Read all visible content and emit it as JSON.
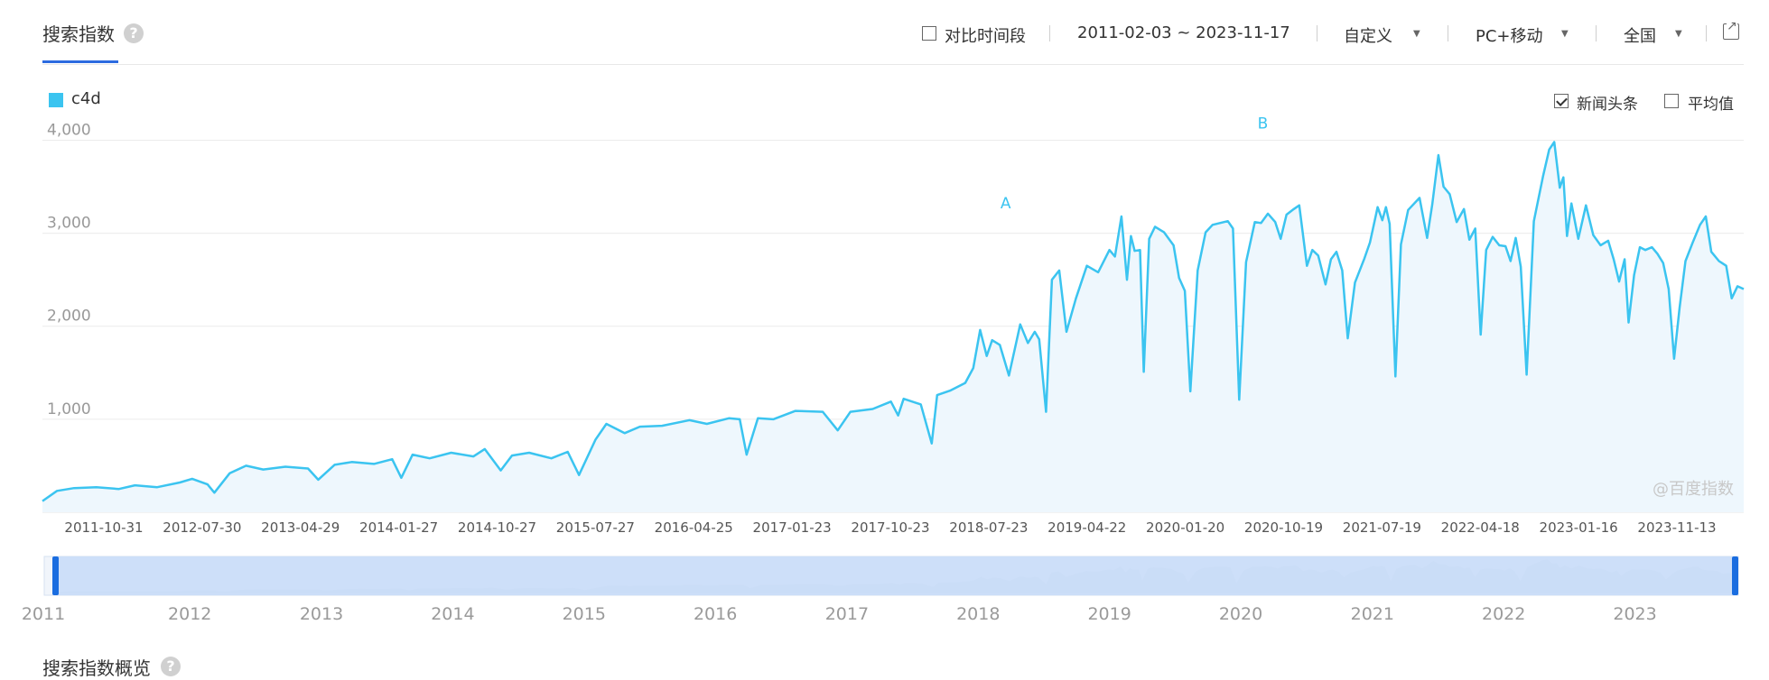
{
  "header": {
    "title": "搜索指数",
    "help_glyph": "?",
    "compare_label": "对比时间段",
    "date_range": "2011-02-03 ~ 2023-11-17",
    "mode_label": "自定义",
    "device_label": "PC+移动",
    "region_label": "全国"
  },
  "options": {
    "news_label": "新闻头条",
    "news_checked": true,
    "avg_label": "平均值",
    "avg_checked": false
  },
  "watermark": "@百度指数",
  "overview_title": "搜索指数概览",
  "colors": {
    "line": "#3bc4f0",
    "fill": "#eef7fd",
    "slider_fill": "#c7daf8",
    "slider_handle": "#1a6de0"
  },
  "chart_data": {
    "type": "area",
    "series": [
      {
        "name": "c4d"
      }
    ],
    "x_tick_labels": [
      "2011-10-31",
      "2012-07-30",
      "2013-04-29",
      "2014-01-27",
      "2014-10-27",
      "2015-07-27",
      "2016-04-25",
      "2017-01-23",
      "2017-10-23",
      "2018-07-23",
      "2019-04-22",
      "2020-01-20",
      "2020-10-19",
      "2021-07-19",
      "2022-04-18",
      "2023-01-16",
      "2023-11-13"
    ],
    "y_tick_labels": [
      "1,000",
      "2,000",
      "3,000",
      "4,000"
    ],
    "y_ticks": [
      1000,
      2000,
      3000,
      4000
    ],
    "ylim": [
      0,
      4150
    ],
    "xlim": [
      "2011-02-03",
      "2023-11-17"
    ],
    "annotations": [
      {
        "label": "A",
        "date": "2018-05-01",
        "value": 3130
      },
      {
        "label": "B",
        "date": "2020-04-06",
        "value": 3990
      }
    ],
    "points": [
      [
        "2011-02-03",
        120
      ],
      [
        "2011-03-15",
        230
      ],
      [
        "2011-05-01",
        260
      ],
      [
        "2011-07-01",
        270
      ],
      [
        "2011-09-01",
        250
      ],
      [
        "2011-10-15",
        290
      ],
      [
        "2011-12-15",
        270
      ],
      [
        "2012-02-15",
        320
      ],
      [
        "2012-03-20",
        360
      ],
      [
        "2012-05-01",
        300
      ],
      [
        "2012-05-20",
        210
      ],
      [
        "2012-07-01",
        420
      ],
      [
        "2012-08-15",
        500
      ],
      [
        "2012-10-01",
        460
      ],
      [
        "2012-12-01",
        490
      ],
      [
        "2013-02-01",
        470
      ],
      [
        "2013-03-01",
        350
      ],
      [
        "2013-04-15",
        510
      ],
      [
        "2013-06-01",
        540
      ],
      [
        "2013-08-01",
        520
      ],
      [
        "2013-09-20",
        570
      ],
      [
        "2013-10-15",
        370
      ],
      [
        "2013-11-15",
        620
      ],
      [
        "2014-01-01",
        580
      ],
      [
        "2014-03-01",
        640
      ],
      [
        "2014-05-01",
        600
      ],
      [
        "2014-06-01",
        680
      ],
      [
        "2014-07-15",
        450
      ],
      [
        "2014-08-15",
        610
      ],
      [
        "2014-10-01",
        640
      ],
      [
        "2014-12-01",
        580
      ],
      [
        "2015-01-15",
        650
      ],
      [
        "2015-02-15",
        400
      ],
      [
        "2015-04-01",
        780
      ],
      [
        "2015-05-01",
        950
      ],
      [
        "2015-06-20",
        850
      ],
      [
        "2015-08-01",
        920
      ],
      [
        "2015-10-01",
        930
      ],
      [
        "2015-12-15",
        990
      ],
      [
        "2016-02-01",
        950
      ],
      [
        "2016-04-01",
        1010
      ],
      [
        "2016-05-01",
        1000
      ],
      [
        "2016-05-20",
        620
      ],
      [
        "2016-06-20",
        1010
      ],
      [
        "2016-08-01",
        1000
      ],
      [
        "2016-10-01",
        1090
      ],
      [
        "2016-12-15",
        1080
      ],
      [
        "2017-01-25",
        880
      ],
      [
        "2017-03-01",
        1080
      ],
      [
        "2017-05-01",
        1110
      ],
      [
        "2017-06-20",
        1190
      ],
      [
        "2017-07-10",
        1040
      ],
      [
        "2017-07-25",
        1220
      ],
      [
        "2017-09-10",
        1160
      ],
      [
        "2017-10-10",
        740
      ],
      [
        "2017-10-25",
        1260
      ],
      [
        "2017-12-01",
        1310
      ],
      [
        "2018-01-10",
        1390
      ],
      [
        "2018-02-01",
        1550
      ],
      [
        "2018-02-20",
        1960
      ],
      [
        "2018-03-10",
        1680
      ],
      [
        "2018-03-25",
        1850
      ],
      [
        "2018-04-15",
        1800
      ],
      [
        "2018-05-10",
        1470
      ],
      [
        "2018-06-10",
        2020
      ],
      [
        "2018-07-01",
        1820
      ],
      [
        "2018-07-20",
        1940
      ],
      [
        "2018-08-01",
        1860
      ],
      [
        "2018-08-20",
        1080
      ],
      [
        "2018-09-05",
        2500
      ],
      [
        "2018-09-25",
        2600
      ],
      [
        "2018-10-15",
        1940
      ],
      [
        "2018-11-10",
        2300
      ],
      [
        "2018-12-10",
        2650
      ],
      [
        "2019-01-10",
        2580
      ],
      [
        "2019-02-10",
        2820
      ],
      [
        "2019-02-25",
        2750
      ],
      [
        "2019-03-15",
        3180
      ],
      [
        "2019-03-30",
        2500
      ],
      [
        "2019-04-10",
        2970
      ],
      [
        "2019-04-20",
        2810
      ],
      [
        "2019-05-05",
        2820
      ],
      [
        "2019-05-15",
        1510
      ],
      [
        "2019-05-30",
        2940
      ],
      [
        "2019-06-15",
        3070
      ],
      [
        "2019-07-10",
        3010
      ],
      [
        "2019-08-05",
        2870
      ],
      [
        "2019-08-20",
        2520
      ],
      [
        "2019-09-05",
        2380
      ],
      [
        "2019-09-20",
        1300
      ],
      [
        "2019-10-10",
        2600
      ],
      [
        "2019-11-01",
        3010
      ],
      [
        "2019-11-20",
        3090
      ],
      [
        "2019-12-10",
        3110
      ],
      [
        "2020-01-01",
        3130
      ],
      [
        "2020-01-15",
        3050
      ],
      [
        "2020-02-01",
        1210
      ],
      [
        "2020-02-20",
        2690
      ],
      [
        "2020-03-15",
        3120
      ],
      [
        "2020-04-01",
        3110
      ],
      [
        "2020-04-20",
        3210
      ],
      [
        "2020-05-10",
        3120
      ],
      [
        "2020-05-25",
        2940
      ],
      [
        "2020-06-10",
        3200
      ],
      [
        "2020-06-30",
        3260
      ],
      [
        "2020-07-15",
        3300
      ],
      [
        "2020-08-05",
        2650
      ],
      [
        "2020-08-20",
        2820
      ],
      [
        "2020-09-05",
        2760
      ],
      [
        "2020-09-25",
        2450
      ],
      [
        "2020-10-10",
        2720
      ],
      [
        "2020-10-25",
        2800
      ],
      [
        "2020-11-10",
        2600
      ],
      [
        "2020-11-25",
        1870
      ],
      [
        "2020-12-15",
        2470
      ],
      [
        "2021-01-10",
        2730
      ],
      [
        "2021-01-25",
        2900
      ],
      [
        "2021-02-15",
        3280
      ],
      [
        "2021-02-28",
        3140
      ],
      [
        "2021-03-10",
        3280
      ],
      [
        "2021-03-20",
        3100
      ],
      [
        "2021-04-05",
        1460
      ],
      [
        "2021-04-20",
        2880
      ],
      [
        "2021-05-10",
        3250
      ],
      [
        "2021-06-10",
        3380
      ],
      [
        "2021-07-01",
        2950
      ],
      [
        "2021-07-15",
        3310
      ],
      [
        "2021-08-01",
        3840
      ],
      [
        "2021-08-15",
        3500
      ],
      [
        "2021-09-01",
        3420
      ],
      [
        "2021-09-20",
        3120
      ],
      [
        "2021-10-10",
        3260
      ],
      [
        "2021-10-25",
        2930
      ],
      [
        "2021-11-10",
        3050
      ],
      [
        "2021-11-25",
        1910
      ],
      [
        "2021-12-10",
        2820
      ],
      [
        "2021-12-28",
        2960
      ],
      [
        "2022-01-15",
        2870
      ],
      [
        "2022-02-01",
        2860
      ],
      [
        "2022-02-15",
        2700
      ],
      [
        "2022-03-01",
        2950
      ],
      [
        "2022-03-15",
        2640
      ],
      [
        "2022-03-31",
        1480
      ],
      [
        "2022-04-20",
        3130
      ],
      [
        "2022-05-15",
        3610
      ],
      [
        "2022-06-01",
        3900
      ],
      [
        "2022-06-15",
        3980
      ],
      [
        "2022-06-30",
        3490
      ],
      [
        "2022-07-10",
        3600
      ],
      [
        "2022-07-20",
        2970
      ],
      [
        "2022-08-01",
        3320
      ],
      [
        "2022-08-20",
        2940
      ],
      [
        "2022-09-10",
        3300
      ],
      [
        "2022-09-30",
        2980
      ],
      [
        "2022-10-20",
        2870
      ],
      [
        "2022-11-10",
        2920
      ],
      [
        "2022-11-25",
        2720
      ],
      [
        "2022-12-10",
        2480
      ],
      [
        "2022-12-25",
        2720
      ],
      [
        "2023-01-05",
        2040
      ],
      [
        "2023-01-20",
        2550
      ],
      [
        "2023-02-05",
        2850
      ],
      [
        "2023-02-20",
        2820
      ],
      [
        "2023-03-10",
        2850
      ],
      [
        "2023-03-25",
        2780
      ],
      [
        "2023-04-10",
        2680
      ],
      [
        "2023-04-25",
        2400
      ],
      [
        "2023-05-10",
        1650
      ],
      [
        "2023-05-25",
        2200
      ],
      [
        "2023-06-10",
        2700
      ],
      [
        "2023-06-30",
        2900
      ],
      [
        "2023-07-20",
        3090
      ],
      [
        "2023-08-05",
        3180
      ],
      [
        "2023-08-20",
        2800
      ],
      [
        "2023-09-10",
        2700
      ],
      [
        "2023-09-30",
        2650
      ],
      [
        "2023-10-15",
        2300
      ],
      [
        "2023-10-31",
        2430
      ],
      [
        "2023-11-17",
        2400
      ]
    ]
  }
}
